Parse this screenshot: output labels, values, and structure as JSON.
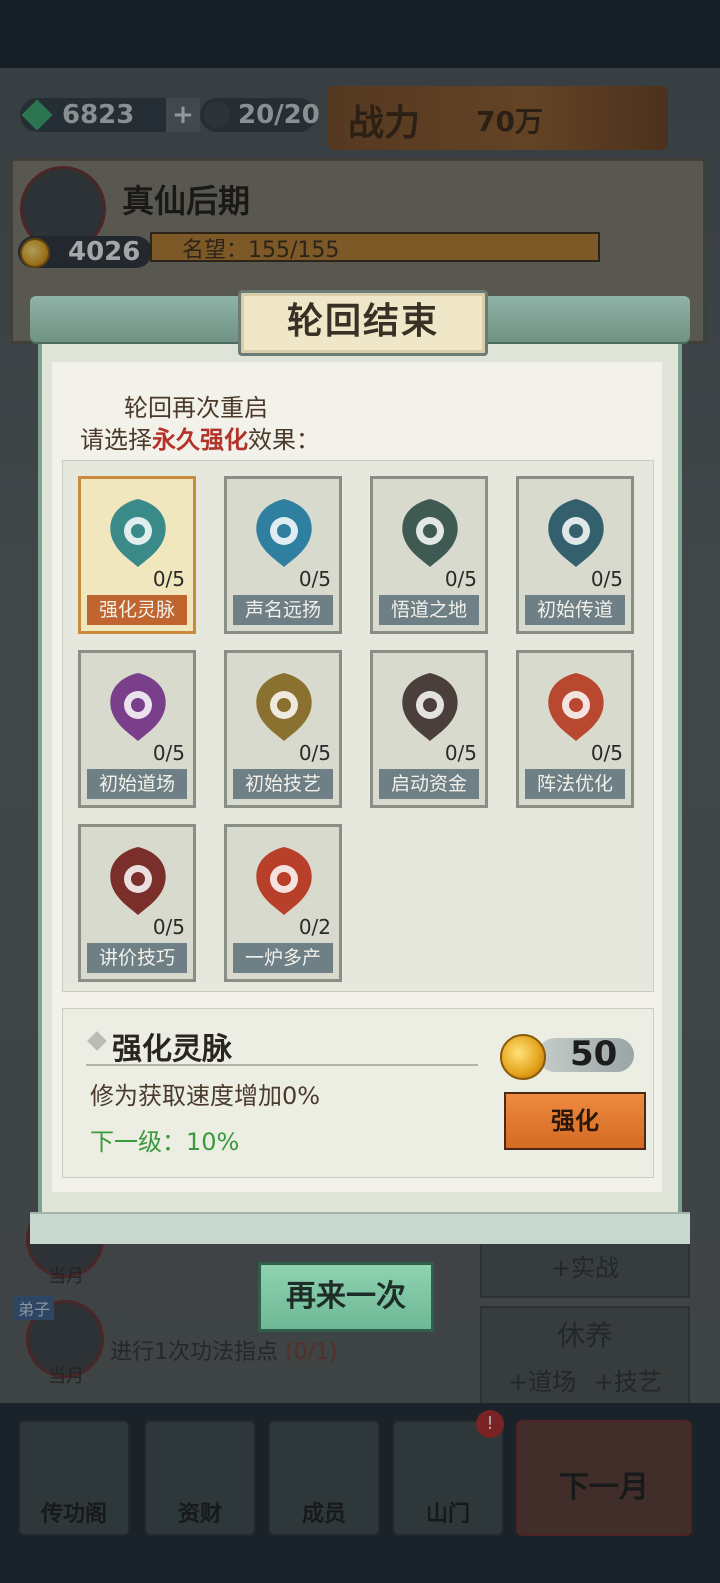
{
  "resources": {
    "jade": "6823",
    "stamina": "20/20",
    "power_label": "战力",
    "power_value": "70万"
  },
  "profile": {
    "realm": "真仙后期",
    "coins": "4026",
    "fame": "名望：155/155",
    "fame_progress": 1.0
  },
  "dialog": {
    "title": "轮回结束",
    "hint_line1": "轮回再次重启",
    "hint_prefix": "请选择",
    "hint_highlight": "永久强化",
    "hint_suffix": "效果：",
    "items": [
      {
        "label": "强化灵脉",
        "level": "0/5",
        "selected": true,
        "icon": "spirit-vein-icon",
        "color": "#3a8a8a"
      },
      {
        "label": "声名远扬",
        "level": "0/5",
        "selected": false,
        "icon": "reputation-icon",
        "color": "#2f7fa0"
      },
      {
        "label": "悟道之地",
        "level": "0/5",
        "selected": false,
        "icon": "yin-yang-icon",
        "color": "#3f5a52"
      },
      {
        "label": "初始传道",
        "level": "0/5",
        "selected": false,
        "icon": "teaching-icon",
        "color": "#34606e"
      },
      {
        "label": "初始道场",
        "level": "0/5",
        "selected": false,
        "icon": "dojo-icon",
        "color": "#7a3f8a"
      },
      {
        "label": "初始技艺",
        "level": "0/5",
        "selected": false,
        "icon": "craft-icon",
        "color": "#8a7130"
      },
      {
        "label": "启动资金",
        "level": "0/5",
        "selected": false,
        "icon": "funds-icon",
        "color": "#4a3f3a"
      },
      {
        "label": "阵法优化",
        "level": "0/5",
        "selected": false,
        "icon": "formation-icon",
        "color": "#b8482f"
      },
      {
        "label": "讲价技巧",
        "level": "0/5",
        "selected": false,
        "icon": "bargain-icon",
        "color": "#7a2f2a"
      },
      {
        "label": "一炉多产",
        "level": "0/2",
        "selected": false,
        "icon": "furnace-icon",
        "color": "#b8402a"
      }
    ],
    "detail": {
      "name": "强化灵脉",
      "desc": "修为获取速度增加0%",
      "next": "下一级：10%",
      "cost": "50",
      "upgrade_label": "强化"
    },
    "again_label": "再来一次"
  },
  "background": {
    "month_label": "当月",
    "disciple_tag": "弟子",
    "task_text": "进行1次功法指点",
    "task_progress": "(0/1)",
    "practice_label": "+实战",
    "rest_label": "休养",
    "dojo_label": "+道场",
    "skill_label": "+技艺"
  },
  "nav": {
    "items": [
      "传功阁",
      "资财",
      "成员",
      "山门"
    ],
    "next_month": "下一月"
  }
}
